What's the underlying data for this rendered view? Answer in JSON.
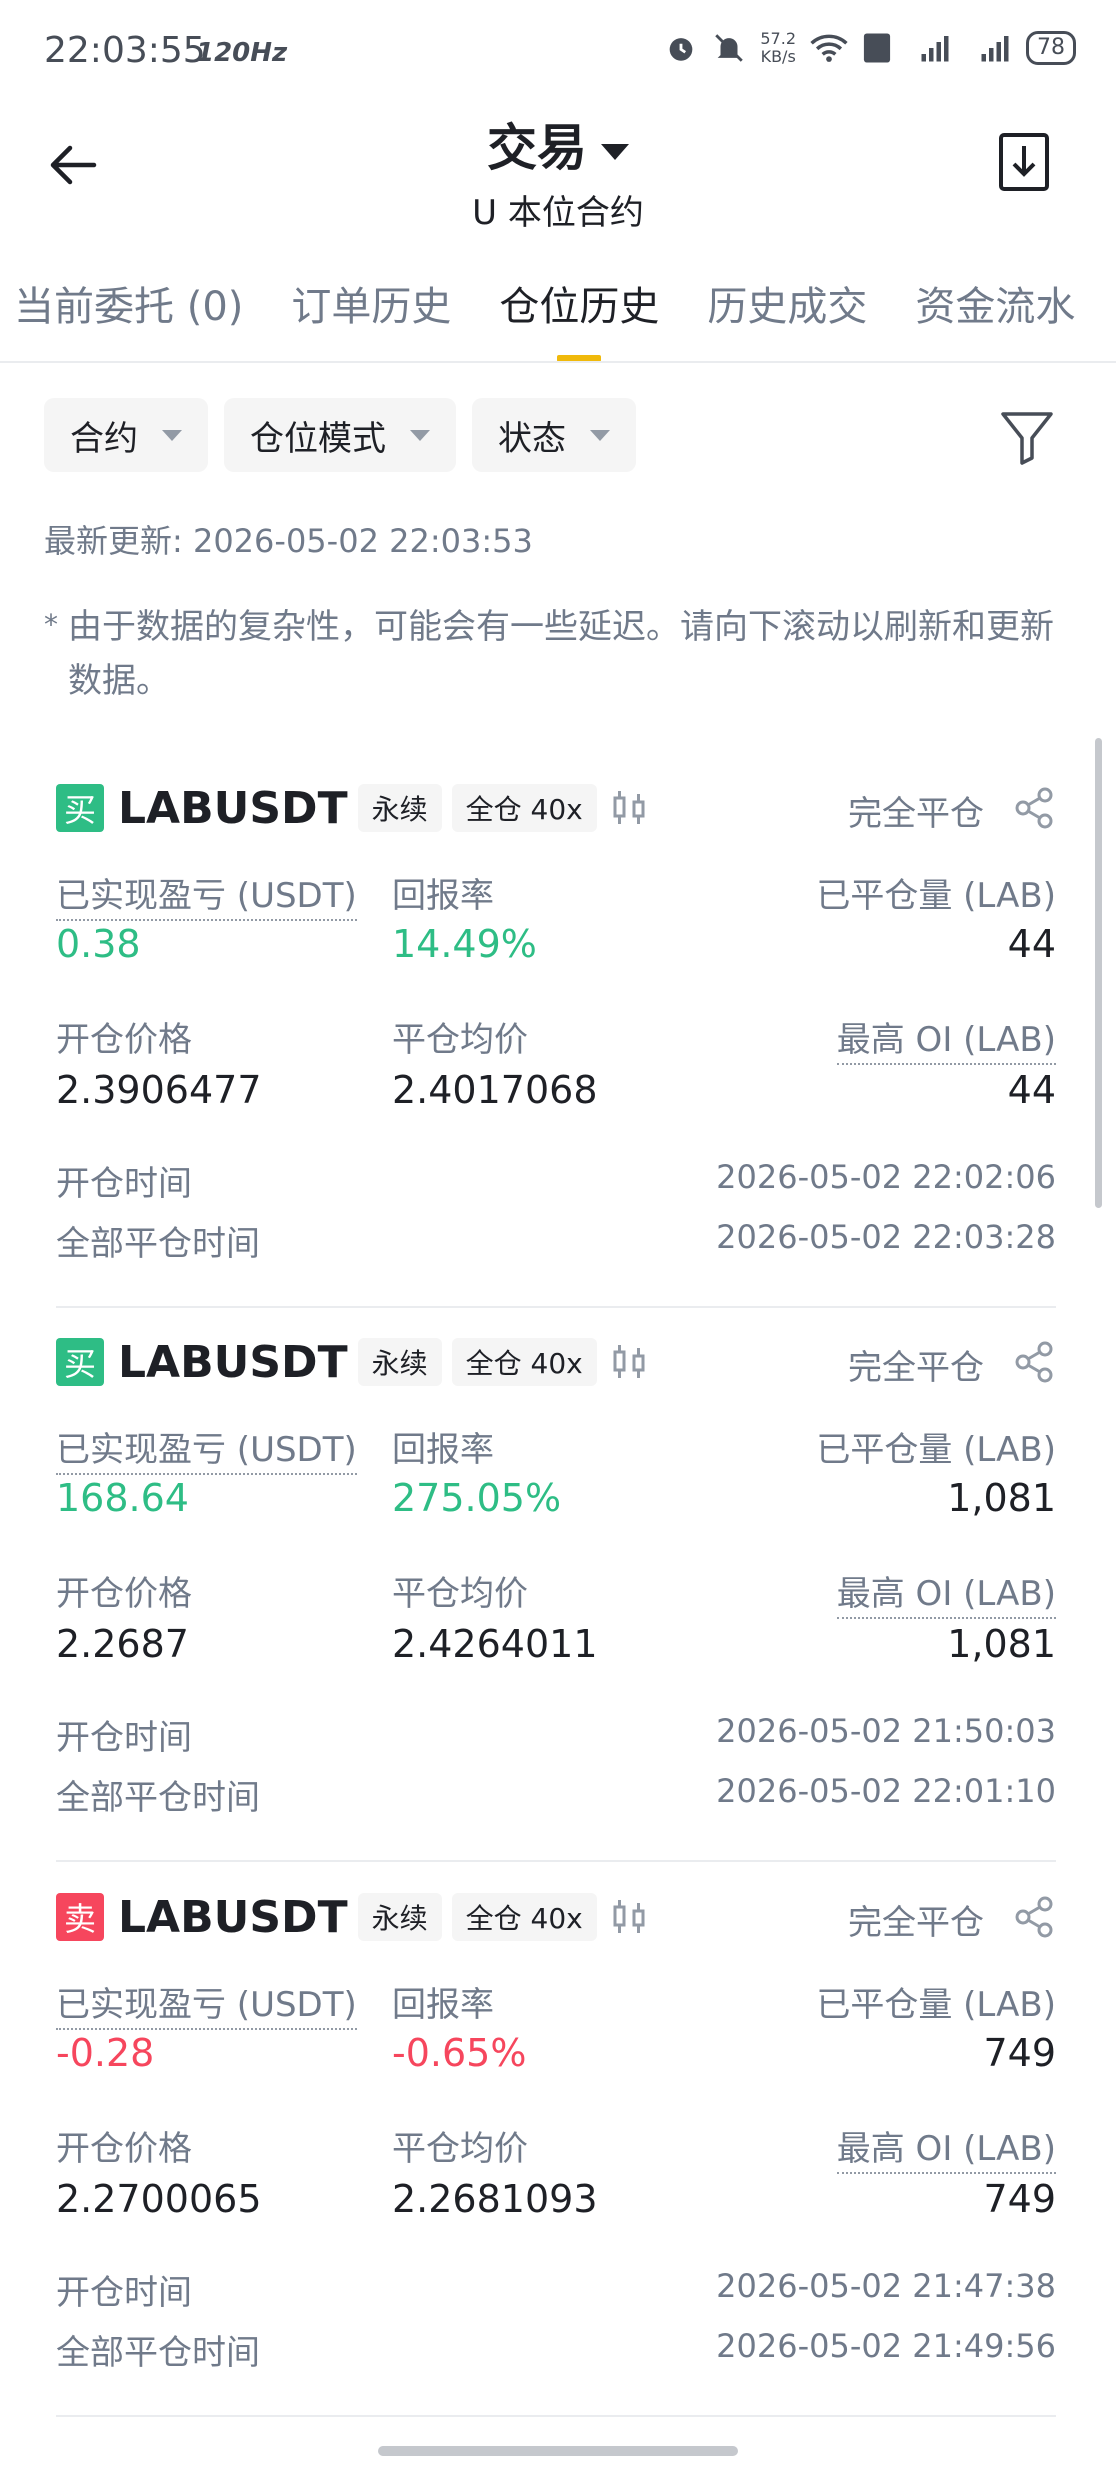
{
  "status_bar": {
    "time": "22:03:55",
    "refresh_rate": "120Hz",
    "net_speed_value": "57.2",
    "net_speed_unit": "KB/s",
    "battery": "78"
  },
  "header": {
    "title": "交易",
    "subtitle": "U 本位合约"
  },
  "tabs": [
    {
      "label": "当前委托 (0)",
      "active": false
    },
    {
      "label": "订单历史",
      "active": false
    },
    {
      "label": "仓位历史",
      "active": true
    },
    {
      "label": "历史成交",
      "active": false
    },
    {
      "label": "资金流水",
      "active": false
    }
  ],
  "filters": [
    {
      "label": "合约"
    },
    {
      "label": "仓位模式"
    },
    {
      "label": "状态"
    }
  ],
  "last_updated": "最新更新: 2026-05-02 22:03:53",
  "note": "由于数据的复杂性，可能会有一些延迟。请向下滚动以刷新和更新数据。",
  "note_marker": "*",
  "labels": {
    "pnl": "已实现盈亏 (USDT)",
    "roi": "回报率",
    "closed_qty": "已平仓量 (LAB)",
    "open_price": "开仓价格",
    "close_avg": "平仓均价",
    "max_oi": "最高 OI (LAB)",
    "open_time": "开仓时间",
    "close_time": "全部平仓时间"
  },
  "positions": [
    {
      "side": "买",
      "side_type": "buy",
      "symbol": "LABUSDT",
      "contract": "永续",
      "margin": "全仓 40x",
      "status": "完全平仓",
      "pnl": "0.38",
      "roi": "14.49%",
      "closed_qty": "44",
      "open_price": "2.3906477",
      "close_avg": "2.4017068",
      "max_oi": "44",
      "open_time": "2026-05-02 22:02:06",
      "close_time": "2026-05-02 22:03:28"
    },
    {
      "side": "买",
      "side_type": "buy",
      "symbol": "LABUSDT",
      "contract": "永续",
      "margin": "全仓 40x",
      "status": "完全平仓",
      "pnl": "168.64",
      "roi": "275.05%",
      "closed_qty": "1,081",
      "open_price": "2.2687",
      "close_avg": "2.4264011",
      "max_oi": "1,081",
      "open_time": "2026-05-02 21:50:03",
      "close_time": "2026-05-02 22:01:10"
    },
    {
      "side": "卖",
      "side_type": "sell",
      "symbol": "LABUSDT",
      "contract": "永续",
      "margin": "全仓 40x",
      "status": "完全平仓",
      "pnl": "-0.28",
      "roi": "-0.65%",
      "closed_qty": "749",
      "open_price": "2.2700065",
      "close_avg": "2.2681093",
      "max_oi": "749",
      "open_time": "2026-05-02 21:47:38",
      "close_time": "2026-05-02 21:49:56"
    }
  ],
  "colors": {
    "accent": "#f0b90b",
    "positive": "#2ebd85",
    "negative": "#f6465d"
  }
}
